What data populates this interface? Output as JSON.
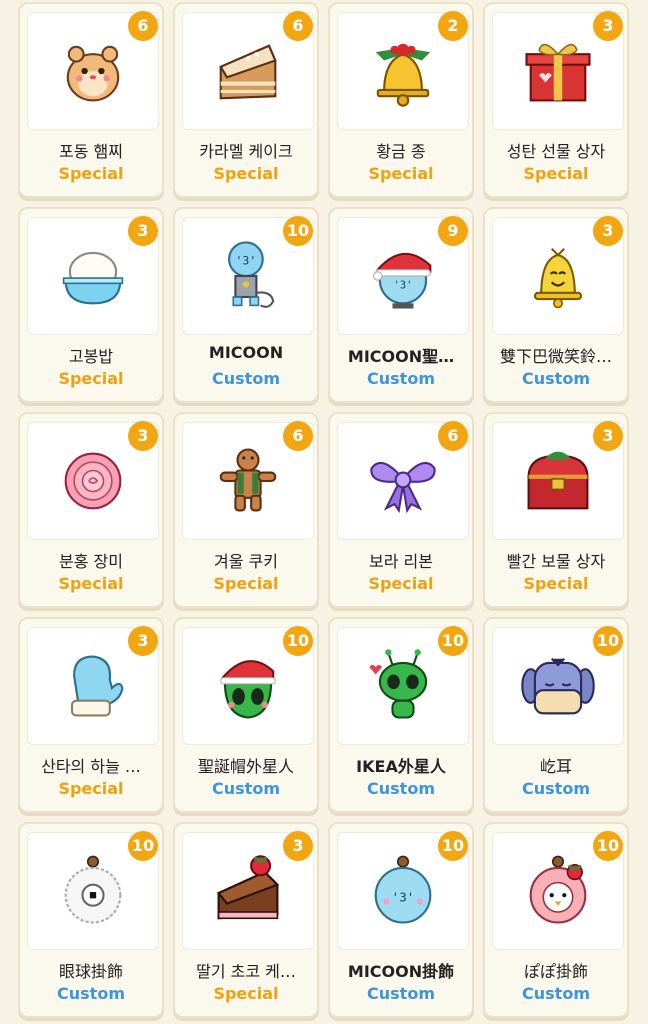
{
  "colors": {
    "special": "#f0a20e",
    "custom": "#3d95dc",
    "badge": "#f2a712",
    "background": "#f7f2e3"
  },
  "items": [
    {
      "name": "포동 햄찌",
      "type": "Special",
      "count": "6",
      "icon": "hamster-icon"
    },
    {
      "name": "카라멜 케이크",
      "type": "Special",
      "count": "6",
      "icon": "caramel-cake-icon"
    },
    {
      "name": "황금 종",
      "type": "Special",
      "count": "2",
      "icon": "golden-bell-icon"
    },
    {
      "name": "성탄 선물 상자",
      "type": "Special",
      "count": "3",
      "icon": "gift-box-icon"
    },
    {
      "name": "고봉밥",
      "type": "Special",
      "count": "3",
      "icon": "rice-bowl-icon"
    },
    {
      "name": "MICOON",
      "type": "Custom",
      "count": "10",
      "icon": "micoon-robot-icon"
    },
    {
      "name": "MICOON聖…",
      "type": "Custom",
      "count": "9",
      "icon": "micoon-santa-icon"
    },
    {
      "name": "雙下巴微笑鈴…",
      "type": "Custom",
      "count": "3",
      "icon": "smiling-bell-icon"
    },
    {
      "name": "분홍 장미",
      "type": "Special",
      "count": "3",
      "icon": "pink-rose-icon"
    },
    {
      "name": "겨울 쿠키",
      "type": "Special",
      "count": "6",
      "icon": "gingerbread-icon"
    },
    {
      "name": "보라 리본",
      "type": "Special",
      "count": "6",
      "icon": "purple-ribbon-icon"
    },
    {
      "name": "빨간 보물 상자",
      "type": "Special",
      "count": "3",
      "icon": "treasure-chest-icon"
    },
    {
      "name": "산타의 하늘 …",
      "type": "Special",
      "count": "3",
      "icon": "mitten-icon"
    },
    {
      "name": "聖誕帽外星人",
      "type": "Custom",
      "count": "10",
      "icon": "santa-alien-icon"
    },
    {
      "name": "IKEA外星人",
      "type": "Custom",
      "count": "10",
      "icon": "alien-icon"
    },
    {
      "name": "屹耳",
      "type": "Custom",
      "count": "10",
      "icon": "eeyore-icon"
    },
    {
      "name": "眼球掛飾",
      "type": "Custom",
      "count": "10",
      "icon": "eyeball-ornament-icon"
    },
    {
      "name": "딸기 초코 케…",
      "type": "Special",
      "count": "3",
      "icon": "strawberry-cake-icon"
    },
    {
      "name": "MICOON掛飾",
      "type": "Custom",
      "count": "10",
      "icon": "micoon-ornament-icon"
    },
    {
      "name": "ぽぽ掛飾",
      "type": "Custom",
      "count": "10",
      "icon": "popo-ornament-icon"
    }
  ]
}
